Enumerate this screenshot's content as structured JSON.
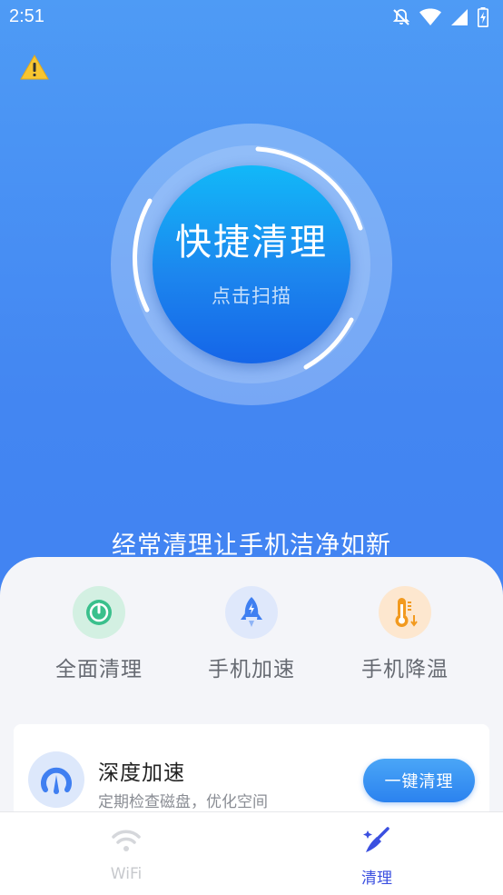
{
  "status_bar": {
    "time": "2:51"
  },
  "scan": {
    "title": "快捷清理",
    "subtitle": "点击扫描"
  },
  "tagline": "经常清理让手机洁净如新",
  "features": [
    {
      "label": "全面清理",
      "icon": "clean-all-icon",
      "color": "#3ac08c"
    },
    {
      "label": "手机加速",
      "icon": "rocket-icon",
      "color": "#3f7ff1"
    },
    {
      "label": "手机降温",
      "icon": "thermometer-icon",
      "color": "#f29a1f"
    }
  ],
  "card": {
    "title": "深度加速",
    "subtitle": "定期检查磁盘，优化空间",
    "button_label": "一键清理",
    "icon": "speedometer-icon"
  },
  "bottom_nav": [
    {
      "label": "WiFi",
      "icon": "wifi-icon",
      "active": false
    },
    {
      "label": "清理",
      "icon": "broom-icon",
      "active": true
    }
  ],
  "colors": {
    "accent": "#3b50e0",
    "background_top": "#4e9bf5",
    "button": "#2b82ef"
  }
}
